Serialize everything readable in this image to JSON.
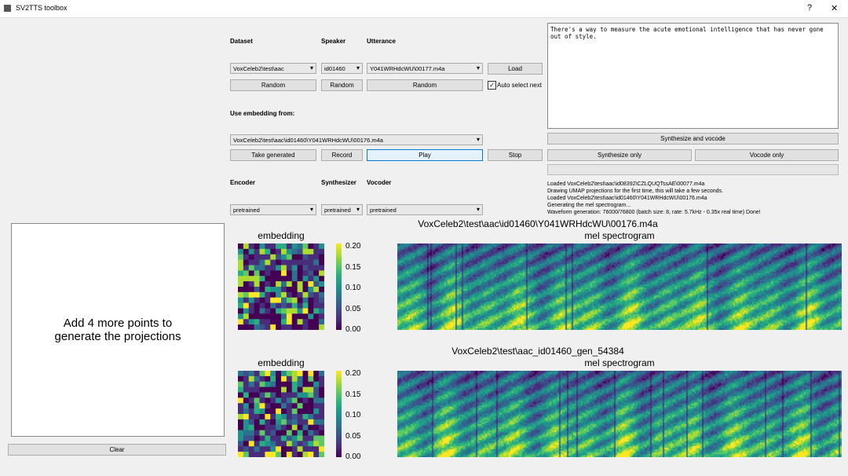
{
  "window": {
    "title": "SV2TTS toolbox",
    "help": "?",
    "close": "✕"
  },
  "labels": {
    "dataset": "Dataset",
    "speaker": "Speaker",
    "utterance": "Utterance",
    "use_embedding": "Use embedding from:",
    "encoder": "Encoder",
    "synthesizer": "Synthesizer",
    "vocoder": "Vocoder"
  },
  "combos": {
    "dataset": "VoxCeleb2\\test\\aac",
    "speaker": "id01460",
    "utterance": "Y041WRHdcWU\\00177.m4a",
    "embedding": "VoxCeleb2\\test\\aac\\id01460\\Y041WRHdcWU\\00176.m4a",
    "encoder": "pretrained",
    "synthesizer": "pretrained",
    "vocoder": "pretrained"
  },
  "buttons": {
    "load": "Load",
    "random_dataset": "Random",
    "random_speaker": "Random",
    "random_utterance": "Random",
    "auto_select": "Auto select next",
    "take_generated": "Take generated",
    "record": "Record",
    "play": "Play",
    "stop": "Stop",
    "synth_vocode": "Synthesize and vocode",
    "synth_only": "Synthesize only",
    "vocode_only": "Vocode only",
    "clear": "Clear"
  },
  "auto_select_checked": true,
  "text_input": "There's a way to measure the acute emotional intelligence that has never gone out of style.",
  "progress": 0,
  "log": [
    "Loaded VoxCeleb2\\test\\aac\\id08392\\CZLQUQTssAE\\00077.m4a",
    "Drawing UMAP projections for the first time, this will take a few seconds.",
    "Loaded VoxCeleb2\\test\\aac\\id01460\\Y041WRHdcWU\\00176.m4a",
    "Generating the mel spectrogram...",
    "Waveform generation: 76000/76800 (batch size: 8, rate: 5.7kHz - 0.35x real time) Done!"
  ],
  "projection_msg": "Add 4 more points to generate the projections",
  "plots": [
    {
      "title": "VoxCeleb2\\test\\aac\\id01460\\Y041WRHdcWU\\00176.m4a",
      "embedding_title": "embedding",
      "spec_title": "mel spectrogram",
      "colorbar_ticks": [
        "0.20",
        "0.15",
        "0.10",
        "0.05",
        "0.00"
      ]
    },
    {
      "title": "VoxCeleb2\\test\\aac_id01460_gen_54384",
      "embedding_title": "embedding",
      "spec_title": "mel spectrogram",
      "colorbar_ticks": [
        "0.20",
        "0.15",
        "0.10",
        "0.05",
        "0.00"
      ]
    }
  ],
  "colormap": "viridis"
}
